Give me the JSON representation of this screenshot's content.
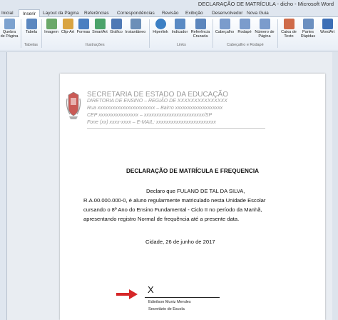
{
  "window": {
    "title": "DECLARAÇÃO DE MATRÍCULA - dicho - Microsoft Word"
  },
  "tabs": [
    "Inicial",
    "Inserir",
    "Layout da Página",
    "Referências",
    "Correspondências",
    "Revisão",
    "Exibição",
    "Desenvolvedor",
    "Nova Guia"
  ],
  "active_tab": "Inserir",
  "ribbon": {
    "buttons": [
      {
        "label": "Quebra",
        "label2": "de Página",
        "icon": "page-break-icon",
        "color": "#7da2cf"
      },
      {
        "label": "Tabela",
        "label2": "",
        "icon": "table-icon",
        "color": "#5b87c0"
      },
      {
        "label": "Imagem",
        "label2": "",
        "icon": "picture-icon",
        "color": "#6aa86a"
      },
      {
        "label": "Clip-Art",
        "label2": "",
        "icon": "clipart-icon",
        "color": "#d9a441"
      },
      {
        "label": "Formas",
        "label2": "",
        "icon": "shapes-icon",
        "color": "#4a7fc1"
      },
      {
        "label": "SmartArt",
        "label2": "",
        "icon": "smartart-icon",
        "color": "#4aa36b"
      },
      {
        "label": "Gráfico",
        "label2": "",
        "icon": "chart-icon",
        "color": "#4f79b5"
      },
      {
        "label": "Instantâneo",
        "label2": "",
        "icon": "screenshot-icon",
        "color": "#6c8fb8"
      },
      {
        "label": "Hiperlink",
        "label2": "",
        "icon": "hyperlink-icon",
        "color": "#3b7fc4"
      },
      {
        "label": "Indicador",
        "label2": "",
        "icon": "bookmark-icon",
        "color": "#5a8ac4"
      },
      {
        "label": "Referência",
        "label2": "Cruzada",
        "icon": "cross-reference-icon",
        "color": "#5c86bd"
      },
      {
        "label": "Cabeçalho",
        "label2": "",
        "icon": "header-icon",
        "color": "#7b9ccc"
      },
      {
        "label": "Rodapé",
        "label2": "",
        "icon": "footer-icon",
        "color": "#7b9ccc"
      },
      {
        "label": "Número de",
        "label2": "Página",
        "icon": "page-number-icon",
        "color": "#7b9ccc"
      },
      {
        "label": "Caixa de",
        "label2": "Texto",
        "icon": "textbox-icon",
        "color": "#cf6b4a"
      },
      {
        "label": "Partes",
        "label2": "Rápidas",
        "icon": "quick-parts-icon",
        "color": "#6b8fc0"
      },
      {
        "label": "WordArt",
        "label2": "",
        "icon": "wordart-icon",
        "color": "#3c6fb6"
      }
    ],
    "groups": [
      "Tabelas",
      "Ilustrações",
      "Links",
      "Cabeçalho e Rodapé"
    ]
  },
  "document": {
    "header": {
      "line1": "SECRETARIA DE ESTADO DA EDUCAÇÃO",
      "line2": "DIRETORIA DE ENSINO – REGIÃO DE XXXXXXXXXXXXXXX",
      "line3": "Rua xxxxxxxxxxxxxxxxxxxxxxx – Bairro xxxxxxxxxxxxxxxxxxx",
      "line4": "CEP xxxxxxxxxxxxxxxx – xxxxxxxxxxxxxxxxxxxxxxxx/SP",
      "line5": "Fone (xx) xxxx-xxxx – E-MAIL: xxxxxxxxxxxxxxxxxxxxxxxx"
    },
    "title": "DECLARAÇÃO DE MATRÍCULA E FREQUENCIA",
    "paragraph": [
      "Declaro que FULANO DE TAL DA SILVA,",
      "R.A.00.000.000-0, é aluno regularmente matriculado nesta Unidade Escolar",
      "cursando o 8º Ano do Ensino Fundamental - Ciclo II no período da Manhã,",
      "apresentando registro Normal de frequência até a presente data."
    ],
    "date": "Cidade, 26 de junho de 2017",
    "signature": {
      "mark": "X",
      "name": "Edinilson Muniz Mendes",
      "role": "Secretário de Escola"
    }
  },
  "colors": {
    "arrow": "#d62728",
    "ribbon_bg": "#f4f7fb",
    "header_text": "#9a9a9a"
  }
}
